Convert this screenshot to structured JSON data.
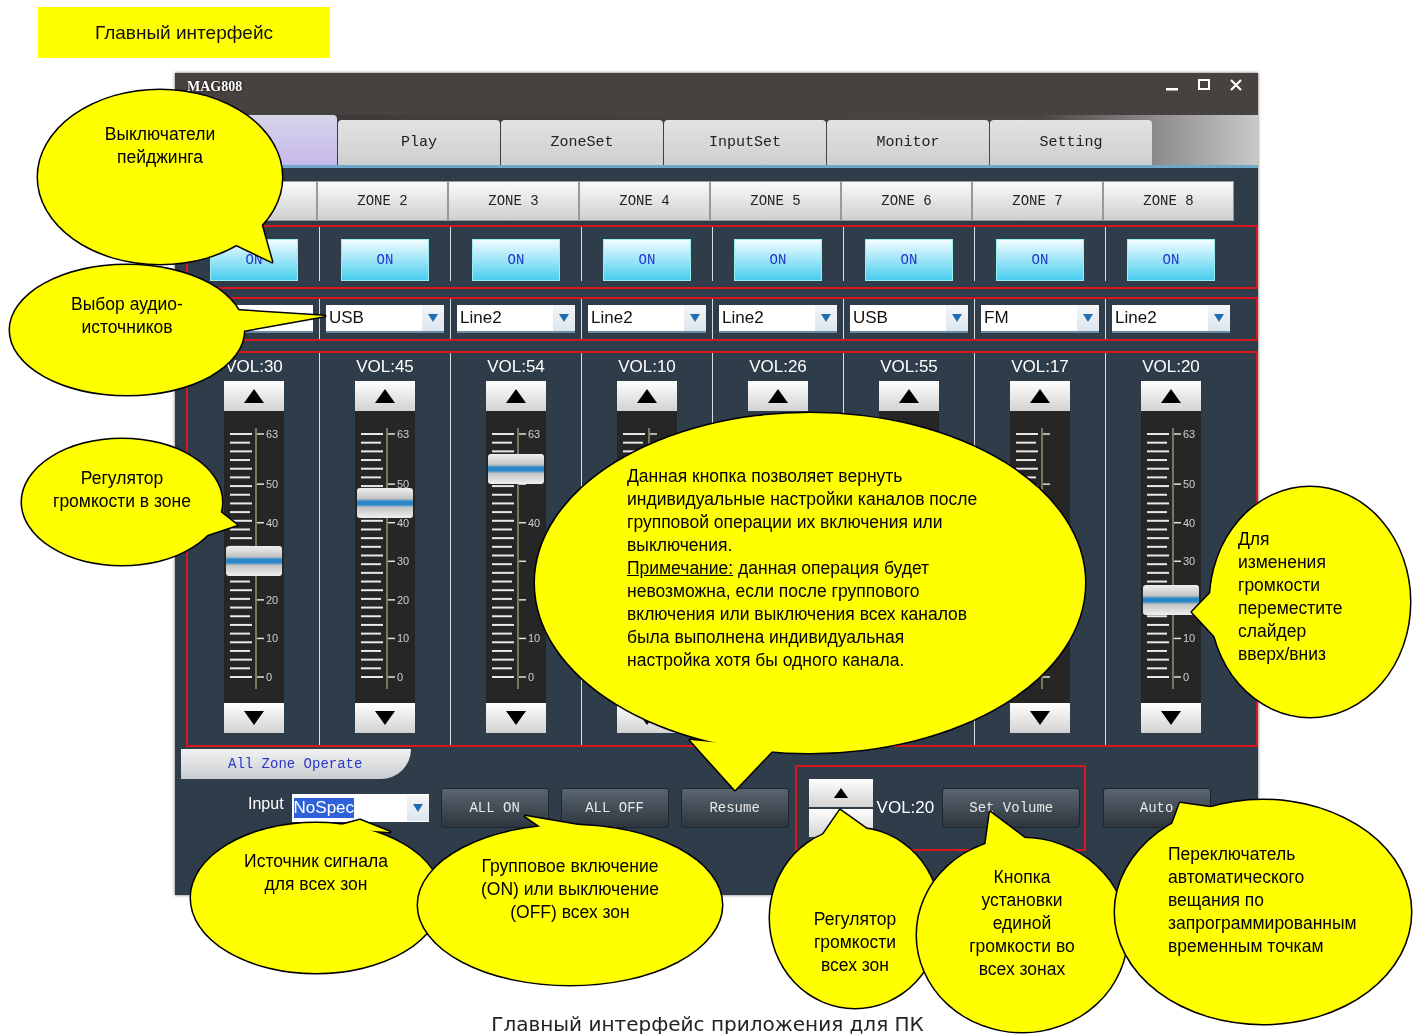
{
  "title_label": "Главный интерфейс",
  "window": {
    "title": "MAG808"
  },
  "tabs": [
    {
      "selected": true
    },
    {
      "label": "Play",
      "selected": false
    },
    {
      "label": "ZoneSet",
      "selected": false
    },
    {
      "label": "InputSet",
      "selected": false
    },
    {
      "label": "Monitor",
      "selected": false
    },
    {
      "label": "Setting",
      "selected": false
    }
  ],
  "zones": [
    {
      "on_button": "ON",
      "volume": "VOL:30",
      "level": 0.476,
      "scale": [
        "63",
        "50",
        "40",
        "20",
        "10",
        "0"
      ]
    },
    {
      "header": "ZONE 2",
      "on_button": "ON",
      "source": "USB",
      "volume": "VOL:45",
      "level": 0.714,
      "scale": [
        "63",
        "50",
        "40",
        "30",
        "20",
        "10",
        "0"
      ]
    },
    {
      "header": "ZONE 3",
      "on_button": "ON",
      "source": "Line2",
      "volume": "VOL:54",
      "level": 0.857,
      "scale": [
        "63",
        "40",
        "10",
        "0"
      ]
    },
    {
      "header": "ZONE 4",
      "on_button": "ON",
      "source": "Line2",
      "volume": "VOL:10"
    },
    {
      "header": "ZONE 5",
      "kind": "up-only",
      "on_button": "ON",
      "source": "Line2",
      "volume": "VOL:26"
    },
    {
      "header": "ZONE 6",
      "kind": "plain-track",
      "on_button": "ON",
      "source": "USB",
      "volume": "VOL:55"
    },
    {
      "header": "ZONE 7",
      "on_button": "ON",
      "source": "FM",
      "volume": "VOL:17"
    },
    {
      "header": "ZONE 8",
      "on_button": "ON",
      "source": "Line2",
      "volume": "VOL:20",
      "level": 0.317,
      "scale": [
        "63",
        "50",
        "40",
        "30",
        "10",
        "0"
      ]
    }
  ],
  "all_zone": {
    "tab": "All Zone Operate",
    "input_label": "Input",
    "input_value": "NoSpec",
    "buttons": [
      "ALL ON",
      "ALL OFF",
      "Resume"
    ],
    "volume": "VOL:20",
    "set_volume_button": "Set Volume",
    "auto_button": "Auto"
  },
  "callouts": [
    {
      "text": "Выключатели пейджинга"
    },
    {
      "text": "Выбор аудио-источников"
    },
    {
      "text": "Регулятор громкости в зоне"
    },
    {
      "text": "Данная кнопка позволяет вернуть индивидуальные настройки каналов после групповой операции их включения или выключения.",
      "note_label": "Примечание:",
      "note": "данная операция будет невозможна, если после группового включения или выключения всех каналов была выполнена индивидуальная настройка хотя бы одного канала."
    },
    {
      "text": "Для изменения громкости переместите слайдер вверх/вниз"
    },
    {
      "text": "Источник сигнала для всех зон"
    },
    {
      "text": "Групповое включение (ON) или выключение (OFF) всех зон"
    },
    {
      "text": "Регулятор громкости всех зон"
    },
    {
      "text": "Кнопка установки единой громкости во всех зонах"
    },
    {
      "text": "Переключатель автоматического вещания по запрограммированным временным точкам"
    }
  ],
  "caption": "Главный интерфейс приложения для ПК"
}
